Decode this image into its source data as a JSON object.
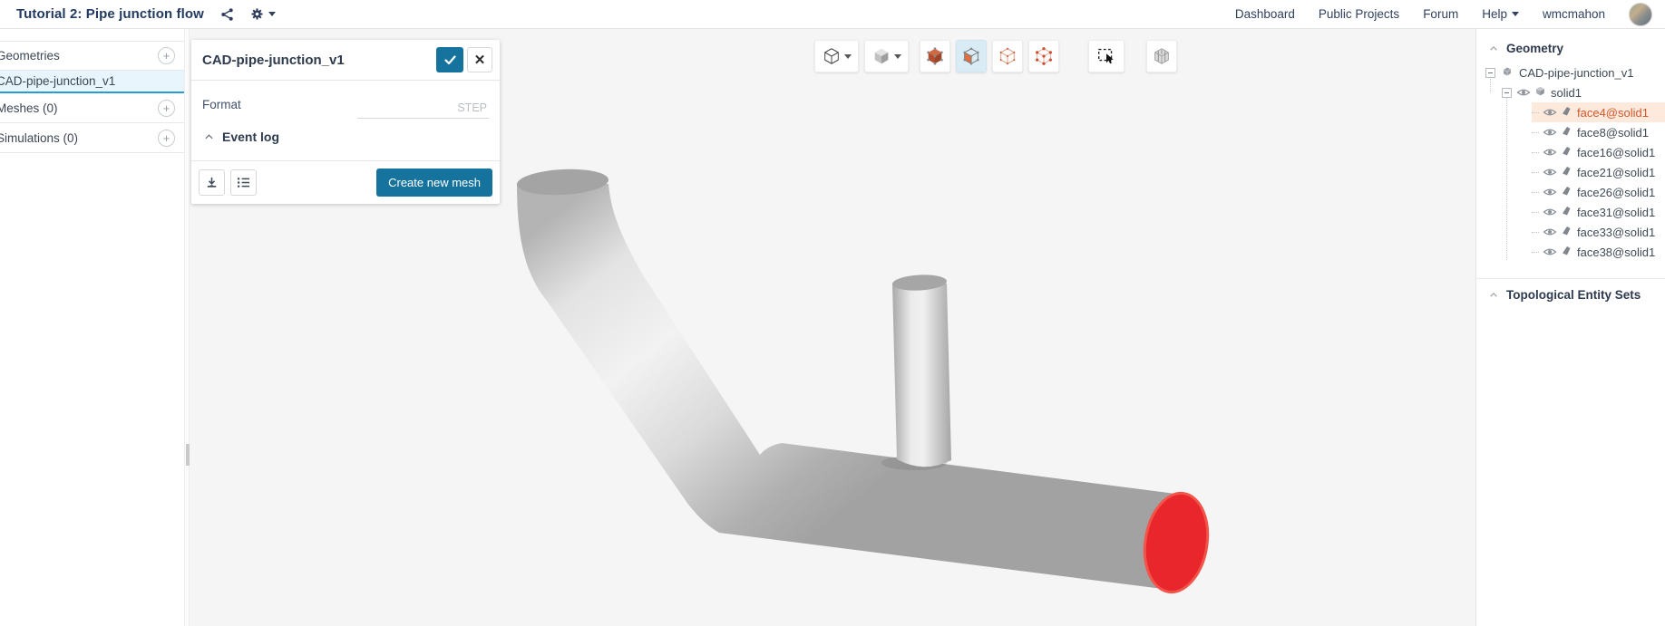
{
  "topbar": {
    "title": "Tutorial 2: Pipe junction flow",
    "nav": [
      "Dashboard",
      "Public Projects",
      "Forum",
      "Help"
    ],
    "username": "wmcmahon"
  },
  "sidebar": {
    "items": [
      {
        "label": "Geometries",
        "has_add": true,
        "selected": false
      },
      {
        "label": "CAD-pipe-junction_v1",
        "has_add": false,
        "selected": true
      },
      {
        "label": "Meshes (0)",
        "has_add": true,
        "selected": false
      },
      {
        "label": "Simulations (0)",
        "has_add": true,
        "selected": false
      }
    ]
  },
  "panel": {
    "title": "CAD-pipe-junction_v1",
    "format_label": "Format",
    "format_value": "STEP",
    "event_log_label": "Event log",
    "create_button_label": "Create new mesh",
    "icons": [
      "confirm-check-icon",
      "close-x-icon",
      "download-icon",
      "event-list-icon"
    ]
  },
  "toolbar": {
    "icons": [
      "view-orientation-cube-icon",
      "render-mode-cube-icon",
      "select-volumes-icon",
      "select-faces-icon",
      "select-edges-icon",
      "select-vertices-icon",
      "box-select-icon",
      "section-cube-icon"
    ],
    "active_tool": "select-faces",
    "active_bg": "#d9ecf5"
  },
  "tree": {
    "header": "Geometry",
    "root": "CAD-pipe-junction_v1",
    "solid": "solid1",
    "faces": [
      "face4@solid1",
      "face8@solid1",
      "face16@solid1",
      "face21@solid1",
      "face26@solid1",
      "face31@solid1",
      "face33@solid1",
      "face38@solid1"
    ],
    "selected_face": "face4@solid1",
    "footer": "Topological Entity Sets"
  },
  "colors": {
    "accent_blue": "#16739e",
    "selection_underline_blue": "#2a9ad2",
    "selected_row_bg": "#e9f5fc",
    "tree_highlight_text": "#d4572c",
    "tree_highlight_bg": "#fdeadd",
    "selected_face_red": "#e8262b",
    "viewport_bg": "#f5f5f6"
  }
}
